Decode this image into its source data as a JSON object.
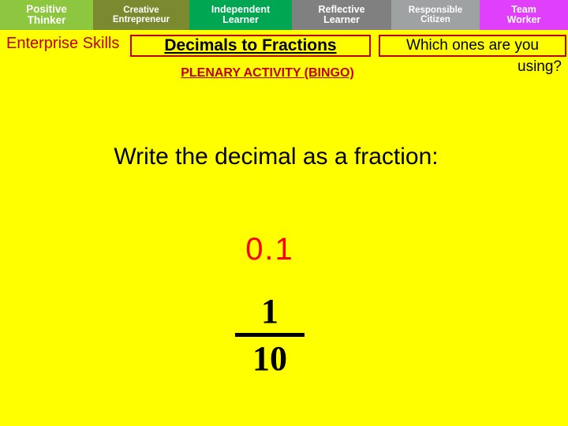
{
  "skills_strip": {
    "items": [
      {
        "lines": [
          "Positive",
          "Thinker"
        ],
        "color": "#8DC63F"
      },
      {
        "lines": [
          "Creative",
          "Entrepreneur"
        ],
        "color": "#7B8A2E"
      },
      {
        "lines": [
          "Independent",
          "Learner"
        ],
        "color": "#00A651"
      },
      {
        "lines": [
          "Reflective",
          "Learner"
        ],
        "color": "#808080"
      },
      {
        "lines": [
          "Responsible",
          "Citizen"
        ],
        "color": "#9EA2A2"
      },
      {
        "lines": [
          "Team",
          "Worker"
        ],
        "color": "#E040FB"
      }
    ]
  },
  "enterprise_label": "Enterprise Skills",
  "title": "Decimals to Fractions",
  "question": {
    "line1": "Which ones are you",
    "line2": "using?"
  },
  "subtitle": "PLENARY ACTIVITY (BINGO)",
  "instruction": "Write the decimal as a fraction:",
  "decimal": "0.1",
  "fraction": {
    "numerator": "1",
    "denominator": "10"
  },
  "colors": {
    "background": "#FFFF00",
    "accent_red": "#C00000",
    "decimal_red": "#FF0000",
    "text_black": "#000000"
  }
}
